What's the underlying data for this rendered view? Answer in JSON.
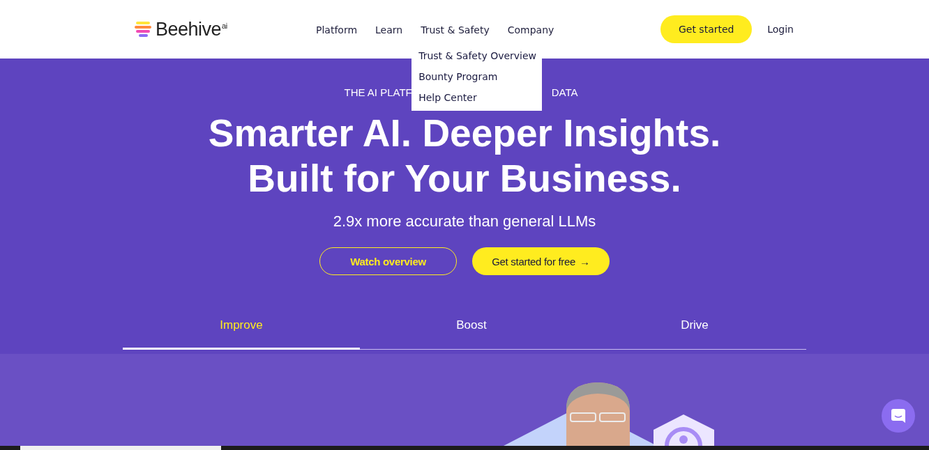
{
  "header": {
    "logo": {
      "name": "Beehive",
      "suffix": "ai"
    },
    "nav": [
      {
        "label": "Platform"
      },
      {
        "label": "Learn"
      },
      {
        "label": "Trust & Safety",
        "dropdown": [
          "Trust & Safety Overview",
          "Bounty Program",
          "Help Center"
        ]
      },
      {
        "label": "Company"
      }
    ],
    "cta": "Get started",
    "login": "Login"
  },
  "hero": {
    "eyebrow_start": "THE AI PLATF",
    "eyebrow_end": "DATA",
    "headline": [
      "Smarter AI. Deeper Insights.",
      "Built for Your Business."
    ],
    "subtitle": "2.9x more accurate than general LLMs",
    "buttons": [
      {
        "label": "Watch overview",
        "kind": "outline"
      },
      {
        "label": "Get started for free",
        "kind": "filled",
        "arrow": "→"
      }
    ]
  },
  "tabs": [
    {
      "label": "Improve",
      "selected": true
    },
    {
      "label": "Boost",
      "selected": false
    },
    {
      "label": "Drive",
      "selected": false
    }
  ]
}
